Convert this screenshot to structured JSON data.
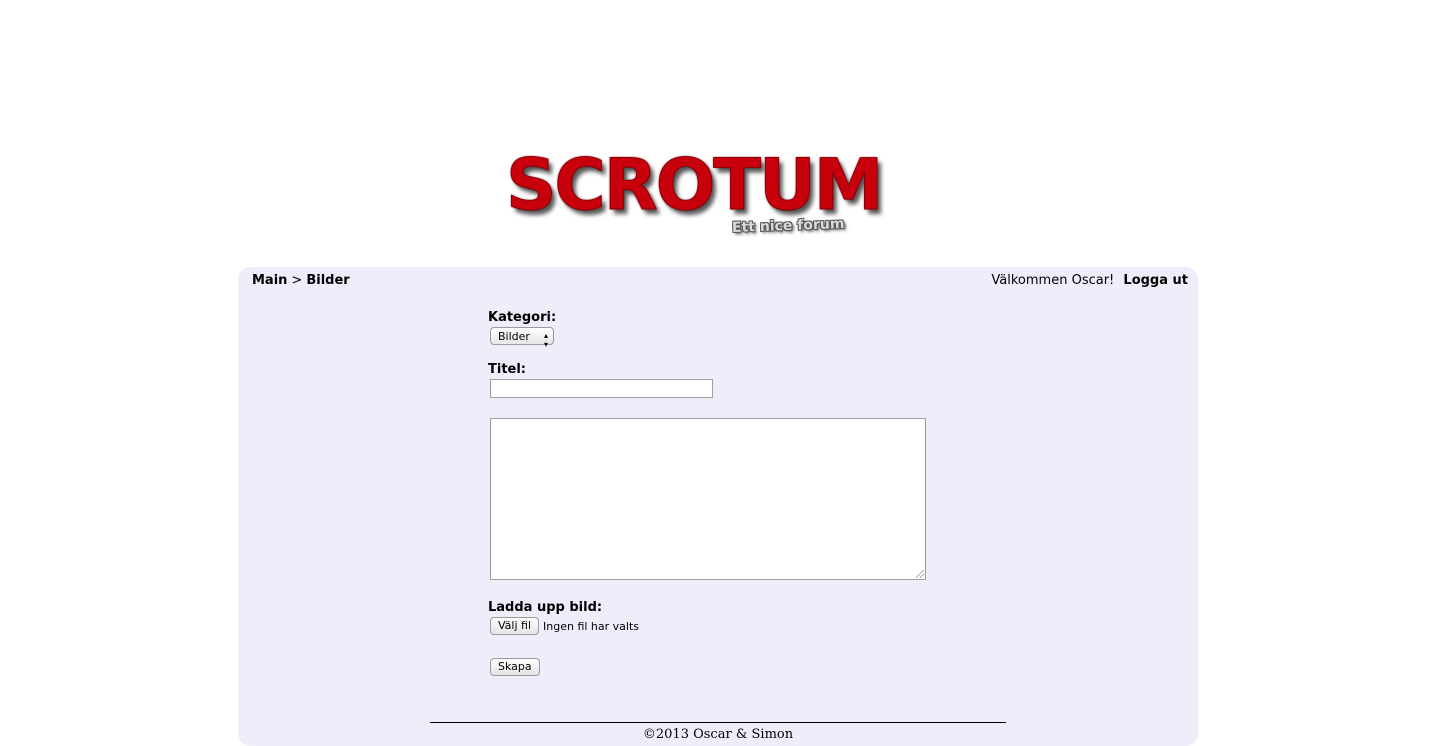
{
  "logo": {
    "title": "SCROTUM",
    "subtitle": "Ett nice forum"
  },
  "breadcrumb": {
    "main": "Main",
    "separator": ">",
    "current": "Bilder"
  },
  "user": {
    "welcome": "Välkommen Oscar!",
    "logout": "Logga ut"
  },
  "form": {
    "category_label": "Kategori:",
    "category_selected": "Bilder",
    "title_label": "Titel:",
    "title_value": "",
    "body_value": "",
    "upload_label": "Ladda upp bild:",
    "choose_file_button": "Välj fil",
    "file_status": "Ingen fil har valts",
    "submit_button": "Skapa"
  },
  "footer": {
    "copyright": "©2013 Oscar & Simon"
  },
  "colors": {
    "logo_red": "#c8000c",
    "panel_bg": "#eeeefb"
  }
}
